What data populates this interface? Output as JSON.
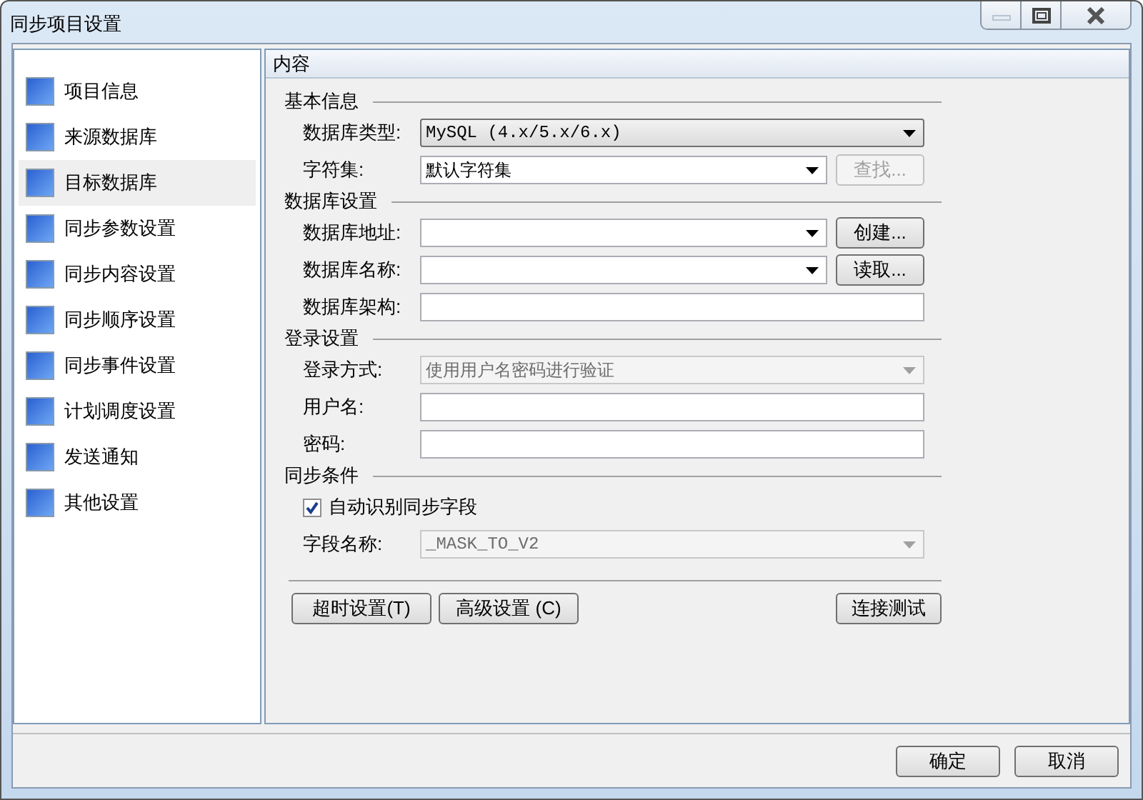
{
  "window": {
    "title": "同步项目设置"
  },
  "sidebar": {
    "items": [
      {
        "label": "项目信息",
        "selected": false
      },
      {
        "label": "来源数据库",
        "selected": false
      },
      {
        "label": "目标数据库",
        "selected": true
      },
      {
        "label": "同步参数设置",
        "selected": false
      },
      {
        "label": "同步内容设置",
        "selected": false
      },
      {
        "label": "同步顺序设置",
        "selected": false
      },
      {
        "label": "同步事件设置",
        "selected": false
      },
      {
        "label": "计划调度设置",
        "selected": false
      },
      {
        "label": "发送通知",
        "selected": false
      },
      {
        "label": "其他设置",
        "selected": false
      }
    ]
  },
  "content": {
    "header": "内容",
    "sections": [
      {
        "title": "基本信息",
        "rows": [
          {
            "kind": "dropdown",
            "label": "数据库类型:",
            "value": "MySQL (4.x/5.x/6.x)"
          },
          {
            "kind": "combo",
            "label": "字符集:",
            "value": "默认字符集",
            "button": {
              "label": "查找...",
              "disabled": true
            }
          }
        ]
      },
      {
        "title": "数据库设置",
        "rows": [
          {
            "kind": "combo",
            "label": "数据库地址:",
            "button": {
              "label": "创建..."
            }
          },
          {
            "kind": "combo",
            "label": "数据库名称:",
            "button": {
              "label": "读取..."
            }
          },
          {
            "kind": "input",
            "label": "数据库架构:"
          }
        ]
      },
      {
        "title": "登录设置",
        "rows": [
          {
            "kind": "combo",
            "label": "登录方式:",
            "value": "使用用户名密码进行验证",
            "disabled": true
          },
          {
            "kind": "input",
            "label": "用户名:"
          },
          {
            "kind": "input",
            "label": "密码:"
          }
        ]
      },
      {
        "title": "同步条件",
        "rows": [
          {
            "kind": "checkbox",
            "label": "自动识别同步字段",
            "checked": true
          },
          {
            "kind": "combo",
            "label": "字段名称:",
            "value": "_MASK_TO_V2",
            "disabled": true
          }
        ]
      }
    ],
    "left_buttons": [
      "超时设置(T)",
      "高级设置 (C)"
    ],
    "right_buttons": [
      "连接测试"
    ]
  },
  "footer_buttons": [
    "确定",
    "取消"
  ]
}
